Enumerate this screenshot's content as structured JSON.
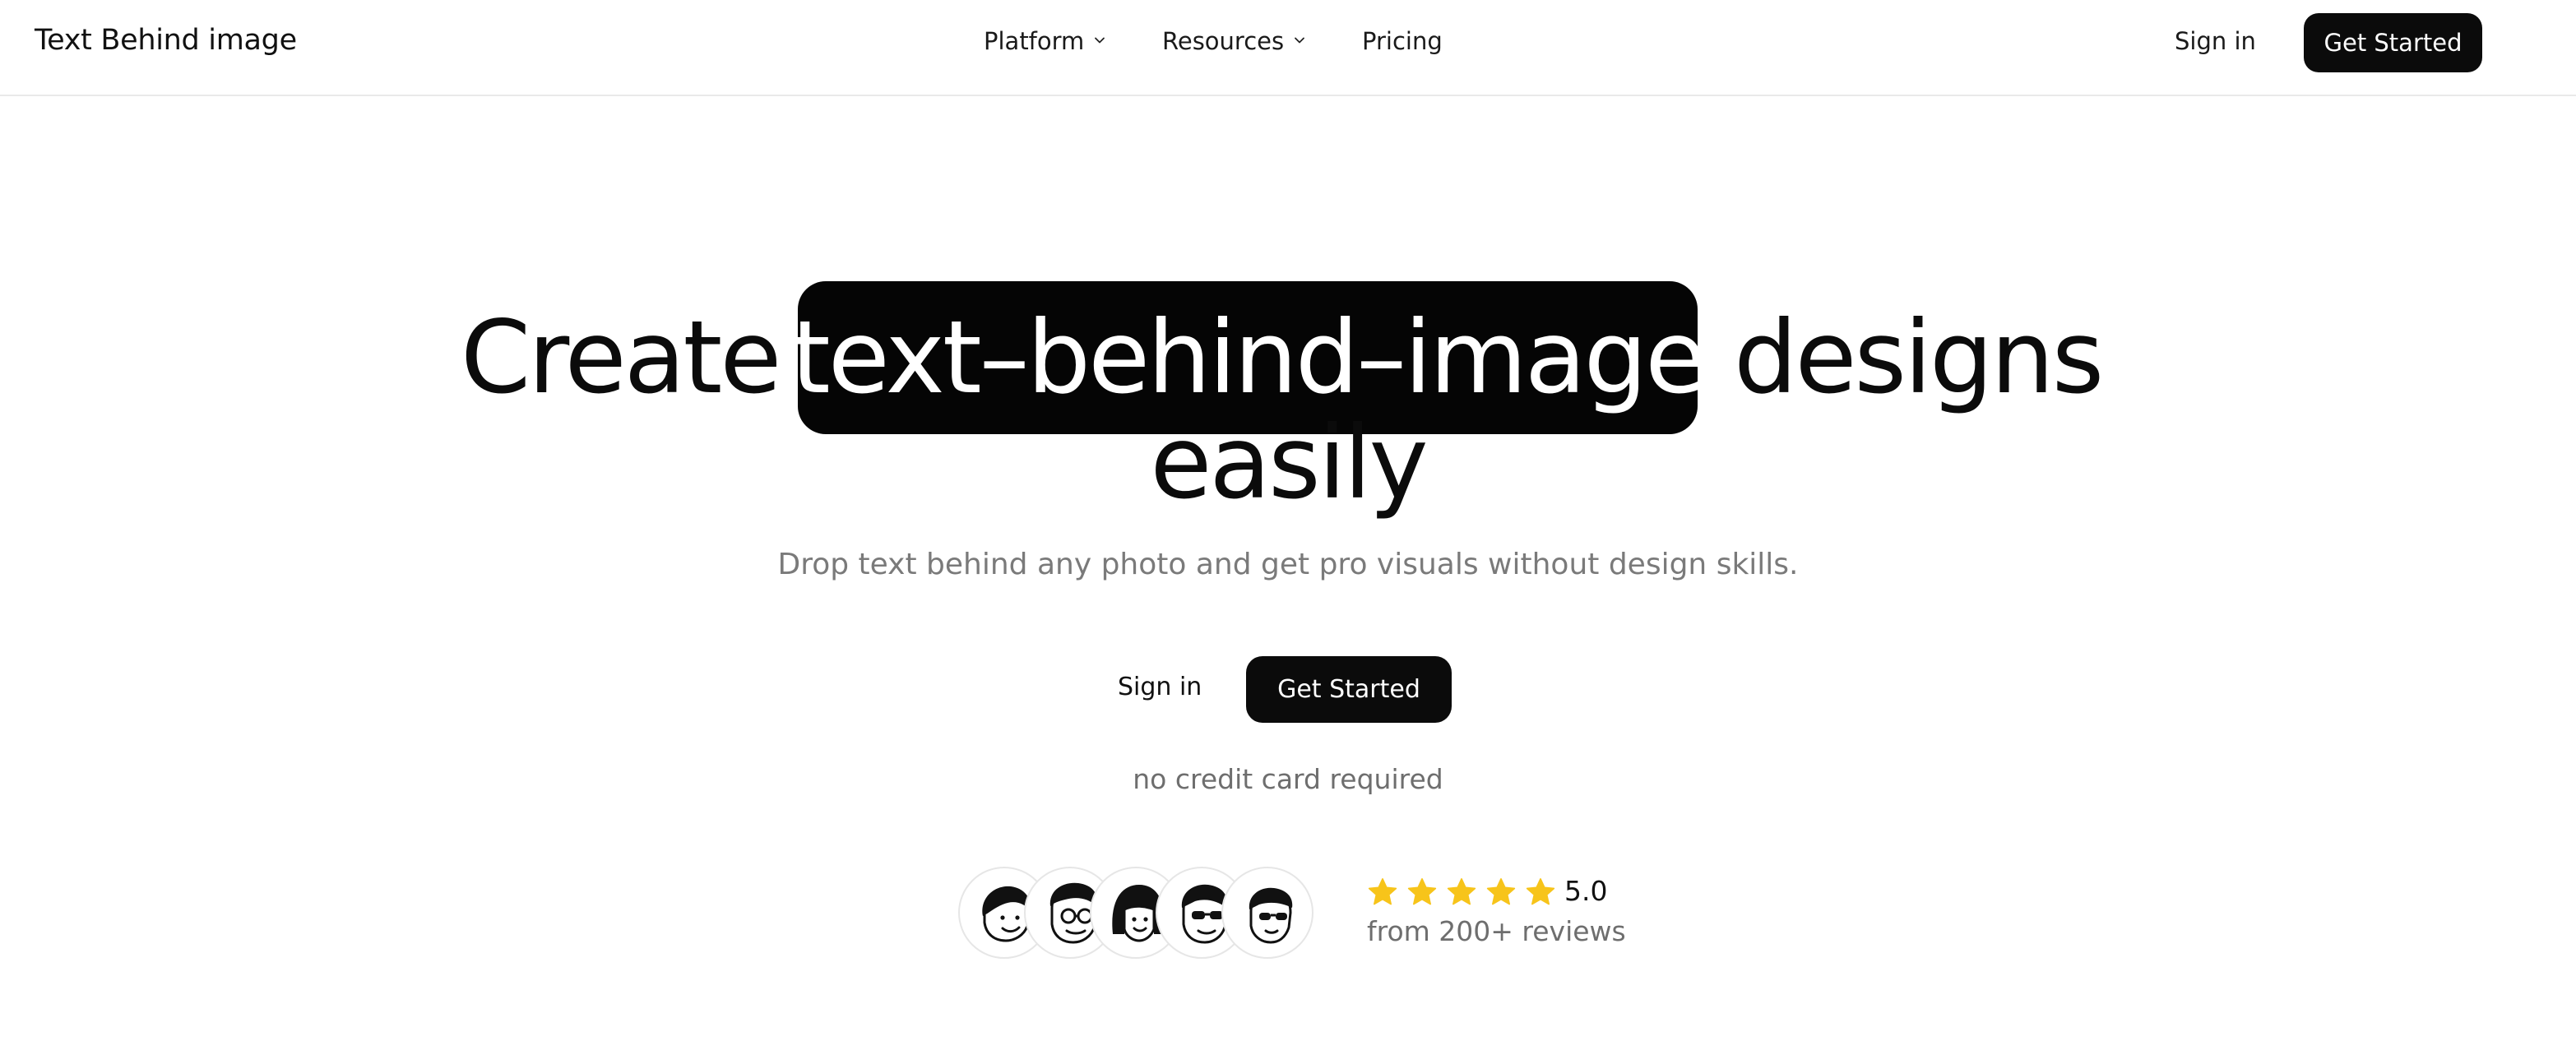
{
  "header": {
    "brand": "Text Behind image",
    "nav": [
      {
        "label": "Platform",
        "has_dropdown": true
      },
      {
        "label": "Resources",
        "has_dropdown": true
      },
      {
        "label": "Pricing",
        "has_dropdown": false
      }
    ],
    "sign_in_label": "Sign in",
    "get_started_label": "Get Started"
  },
  "hero": {
    "title_prefix": "Create",
    "title_highlight": "text–behind–image",
    "title_suffix": "designs",
    "title_line2": "easily",
    "subtitle": "Drop text behind any photo and get pro visuals without design skills.",
    "sign_in_label": "Sign in",
    "get_started_label": "Get Started",
    "note": "no credit card required"
  },
  "social_proof": {
    "avatars": [
      "avatar-1",
      "avatar-2",
      "avatar-3",
      "avatar-4",
      "avatar-5"
    ],
    "stars": 5,
    "rating": "5.0",
    "reviews_text": "from 200+ reviews"
  },
  "colors": {
    "primary": "#0b0b0b",
    "star": "#f7c41a",
    "muted_text": "#7a7a7a",
    "border": "#e9e9e9"
  },
  "icons": [
    "chevron-down-icon",
    "star-icon",
    "avatar-illustration-icon"
  ]
}
